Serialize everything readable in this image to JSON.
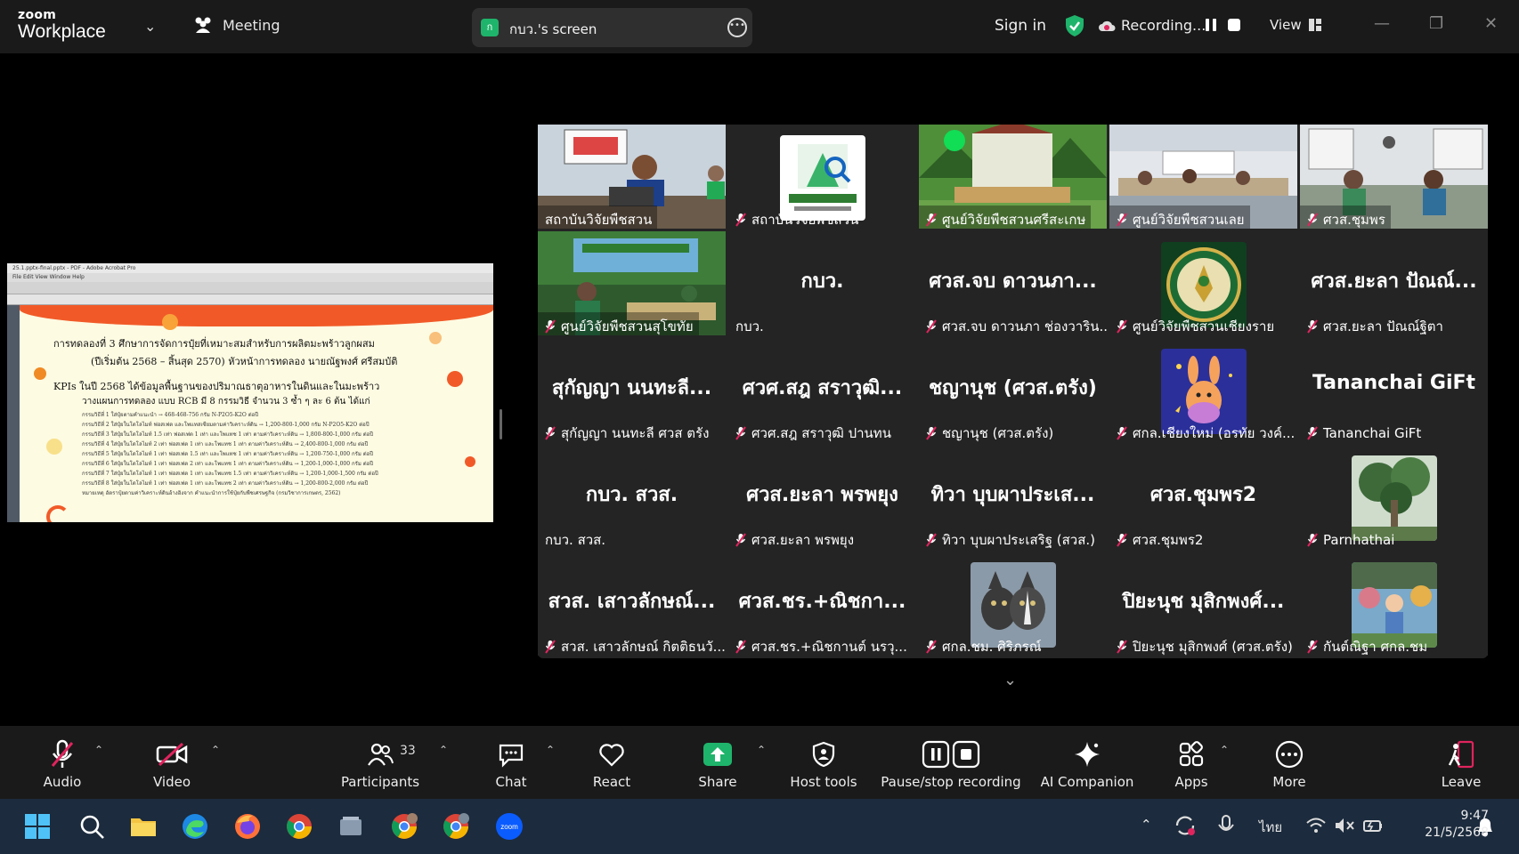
{
  "app": {
    "brand_top": "zoom",
    "brand_bottom": "Workplace",
    "meeting_label": "Meeting",
    "screen_pill": "กบว.'s screen",
    "screen_badge": "ก",
    "sign_in": "Sign in",
    "recording": "Recording...",
    "view": "View"
  },
  "shared_doc": {
    "window_title": "25.1.pptx-final.pptx - PDF - Adobe Acrobat Pro",
    "menu": "File  Edit  View  Window  Help",
    "heading1": "การทดลองที่ 3 ศึกษาการจัดการปุ๋ยที่เหมาะสมสำหรับการผลิตมะพร้าวลูกผสม",
    "heading2": "(ปีเริ่มต้น 2568 – สิ้นสุด 2570) หัวหน้าการทดลอง นายณัฐพงศ์ ศรีสมบัติ",
    "heading3": "KPIs ในปี 2568 ได้ข้อมูลพื้นฐานของปริมาณธาตุอาหารในดินและในมะพร้าว",
    "heading4": "วางแผนการทดลอง แบบ RCB มี 8 กรรมวิธี จำนวน 3 ซ้ำ ๆ ละ 6 ต้น ได้แก่",
    "lines": [
      "กรรมวิธีที่ 1 ใส่ปุ๋ยตามคำแนะนำ → 468-468-756 กรัม N-P2O5-K2O ต่อปี",
      "กรรมวิธีที่ 2 ใส่ปุ๋ยในโดโลไมท์ ฟอสเฟต และโพแทสเซียมตามค่าวิเคราะห์ดิน → 1,200-800-1,000 กรัม N-P2O5-K2O ต่อปี",
      "กรรมวิธีที่ 3 ใส่ปุ๋ยในโดโลไมท์ 1.5 เท่า ฟอสเฟต 1 เท่า และโพแทช 1 เท่า ตามค่าวิเคราะห์ดิน → 1,800-800-1,000 กรัม ต่อปี",
      "กรรมวิธีที่ 4 ใส่ปุ๋ยในโดโลไมท์ 2 เท่า ฟอสเฟต 1 เท่า และโพแทช 1 เท่า ตามค่าวิเคราะห์ดิน → 2,400-800-1,000 กรัม ต่อปี",
      "กรรมวิธีที่ 5 ใส่ปุ๋ยในโดโลไมท์ 1 เท่า ฟอสเฟต 1.5 เท่า และโพแทช 1 เท่า ตามค่าวิเคราะห์ดิน → 1,200-750-1,000 กรัม ต่อปี",
      "กรรมวิธีที่ 6 ใส่ปุ๋ยในโดโลไมท์ 1 เท่า ฟอสเฟต 2 เท่า และโพแทช 1 เท่า ตามค่าวิเคราะห์ดิน → 1,200-1,000-1,000 กรัม ต่อปี",
      "กรรมวิธีที่ 7 ใส่ปุ๋ยในโดโลไมท์ 1 เท่า ฟอสเฟต 1 เท่า และโพแทช 1.5 เท่า ตามค่าวิเคราะห์ดิน → 1,200-1,000-1,500 กรัม ต่อปี",
      "กรรมวิธีที่ 8 ใส่ปุ๋ยในโดโลไมท์ 1 เท่า ฟอสเฟต 1 เท่า และโพแทช 2 เท่า ตามค่าวิเคราะห์ดิน → 1,200-800-2,000 กรัม ต่อปี",
      "หมายเหตุ อัตราปุ๋ยตามค่าวิเคราะห์ดินอ้างอิงจาก คำแนะนำการใช้ปุ๋ยกับพืชเศรษฐกิจ (กรมวิชาการเกษตร, 2562)"
    ]
  },
  "participants": [
    {
      "type": "photo",
      "scene": "office",
      "name": "สถาบันวิจัยพืชสวน",
      "muted": false,
      "active": true
    },
    {
      "type": "logo",
      "scene": "hri-logo",
      "name": "สถาบันวิจัยพืชสวน",
      "muted": true
    },
    {
      "type": "photo",
      "scene": "stage",
      "name": "ศูนย์วิจัยพืชสวนศรีสะเกษ",
      "muted": true
    },
    {
      "type": "photo",
      "scene": "room",
      "name": "ศูนย์วิจัยพืชสวนเลย",
      "muted": true
    },
    {
      "type": "photo",
      "scene": "room2",
      "name": "ศวส.ชุมพร",
      "muted": true
    },
    {
      "type": "photo",
      "scene": "stage2",
      "name": "ศูนย์วิจัยพืชสวนสุโขทัย",
      "muted": true
    },
    {
      "type": "text",
      "big": "กบว.",
      "name": "กบว.",
      "muted": false
    },
    {
      "type": "text",
      "big": "ศวส.จบ ดาวนภา...",
      "name": "ศวส.จบ ดาวนภา ช่องวาริน...",
      "muted": true
    },
    {
      "type": "logo",
      "scene": "seal",
      "name": "ศูนย์วิจัยพืชสวนเชียงราย",
      "muted": true
    },
    {
      "type": "text",
      "big": "ศวส.ยะลา  ปัณณ์...",
      "name": "ศวส.ยะลา  ปัณณ์ฐิตา",
      "muted": true
    },
    {
      "type": "text",
      "big": "สุกัญญา นนทะลี...",
      "name": "สุกัญญา นนทะลี ศวส ตรัง",
      "muted": true
    },
    {
      "type": "text",
      "big": "ศวศ.สฎ สราวุฒิ...",
      "name": "ศวศ.สฎ สราวุฒิ ปานทน",
      "muted": true
    },
    {
      "type": "text",
      "big": "ชญานุช (ศวส.ตรัง)",
      "name": "ชญานุช (ศวส.ตรัง)",
      "muted": true
    },
    {
      "type": "logo",
      "scene": "cartoon",
      "name": "ศกล.เชียงใหม่ (อรทัย วงค์...",
      "muted": true
    },
    {
      "type": "text",
      "big": "Tananchai GiFt",
      "name": "Tananchai GiFt",
      "muted": true
    },
    {
      "type": "text",
      "big": "กบว. สวส.",
      "name": "กบว. สวส.",
      "muted": false
    },
    {
      "type": "text",
      "big": "ศวส.ยะลา พรพยุง",
      "name": "ศวส.ยะลา พรพยุง",
      "muted": true
    },
    {
      "type": "text",
      "big": "ทิวา บุบผาประเส...",
      "name": "ทิวา บุบผาประเสริฐ (สวส.)",
      "muted": true
    },
    {
      "type": "text",
      "big": "ศวส.ชุมพร2",
      "name": "ศวส.ชุมพร2",
      "muted": true
    },
    {
      "type": "logo",
      "scene": "tree",
      "name": "Parnhathai",
      "muted": true
    },
    {
      "type": "text",
      "big": "สวส. เสาวลักษณ์...",
      "name": "สวส. เสาวลักษณ์ กิตติธนวั...",
      "muted": true
    },
    {
      "type": "text",
      "big": "ศวส.ชร.+ณิชกา...",
      "name": "ศวส.ชร.+ณิชกานต์ นรวุ...",
      "muted": true
    },
    {
      "type": "logo",
      "scene": "dogs",
      "name": "ศกล.ชม. ศิริภรณ์",
      "muted": true
    },
    {
      "type": "text",
      "big": "ปิยะนุช มุสิกพงศ์...",
      "name": "ปิยะนุช มุสิกพงศ์ (ศวส.ตรัง)",
      "muted": true
    },
    {
      "type": "logo",
      "scene": "garden",
      "name": "กันต์ณิฐา ศกล.ชม",
      "muted": true
    }
  ],
  "controls": {
    "audio": "Audio",
    "video": "Video",
    "participants": "Participants",
    "participants_count": "33",
    "chat": "Chat",
    "react": "React",
    "share": "Share",
    "host_tools": "Host tools",
    "pause_stop": "Pause/stop recording",
    "ai_companion": "AI Companion",
    "apps": "Apps",
    "more": "More",
    "leave": "Leave"
  },
  "taskbar": {
    "apps": [
      "start",
      "search",
      "file-explorer",
      "edge",
      "firefox",
      "chrome",
      "window-manager",
      "chrome-profile-1",
      "chrome-profile-2",
      "zoom"
    ],
    "language": "ไทย",
    "time": "9:47",
    "date": "21/5/2568"
  },
  "colors": {
    "active_speaker": "#1fd071",
    "share_green": "#1fb46b",
    "muted_red": "#e0245e",
    "accent_orange": "#f15a28",
    "taskbar_bg": "#1c2b3d"
  }
}
